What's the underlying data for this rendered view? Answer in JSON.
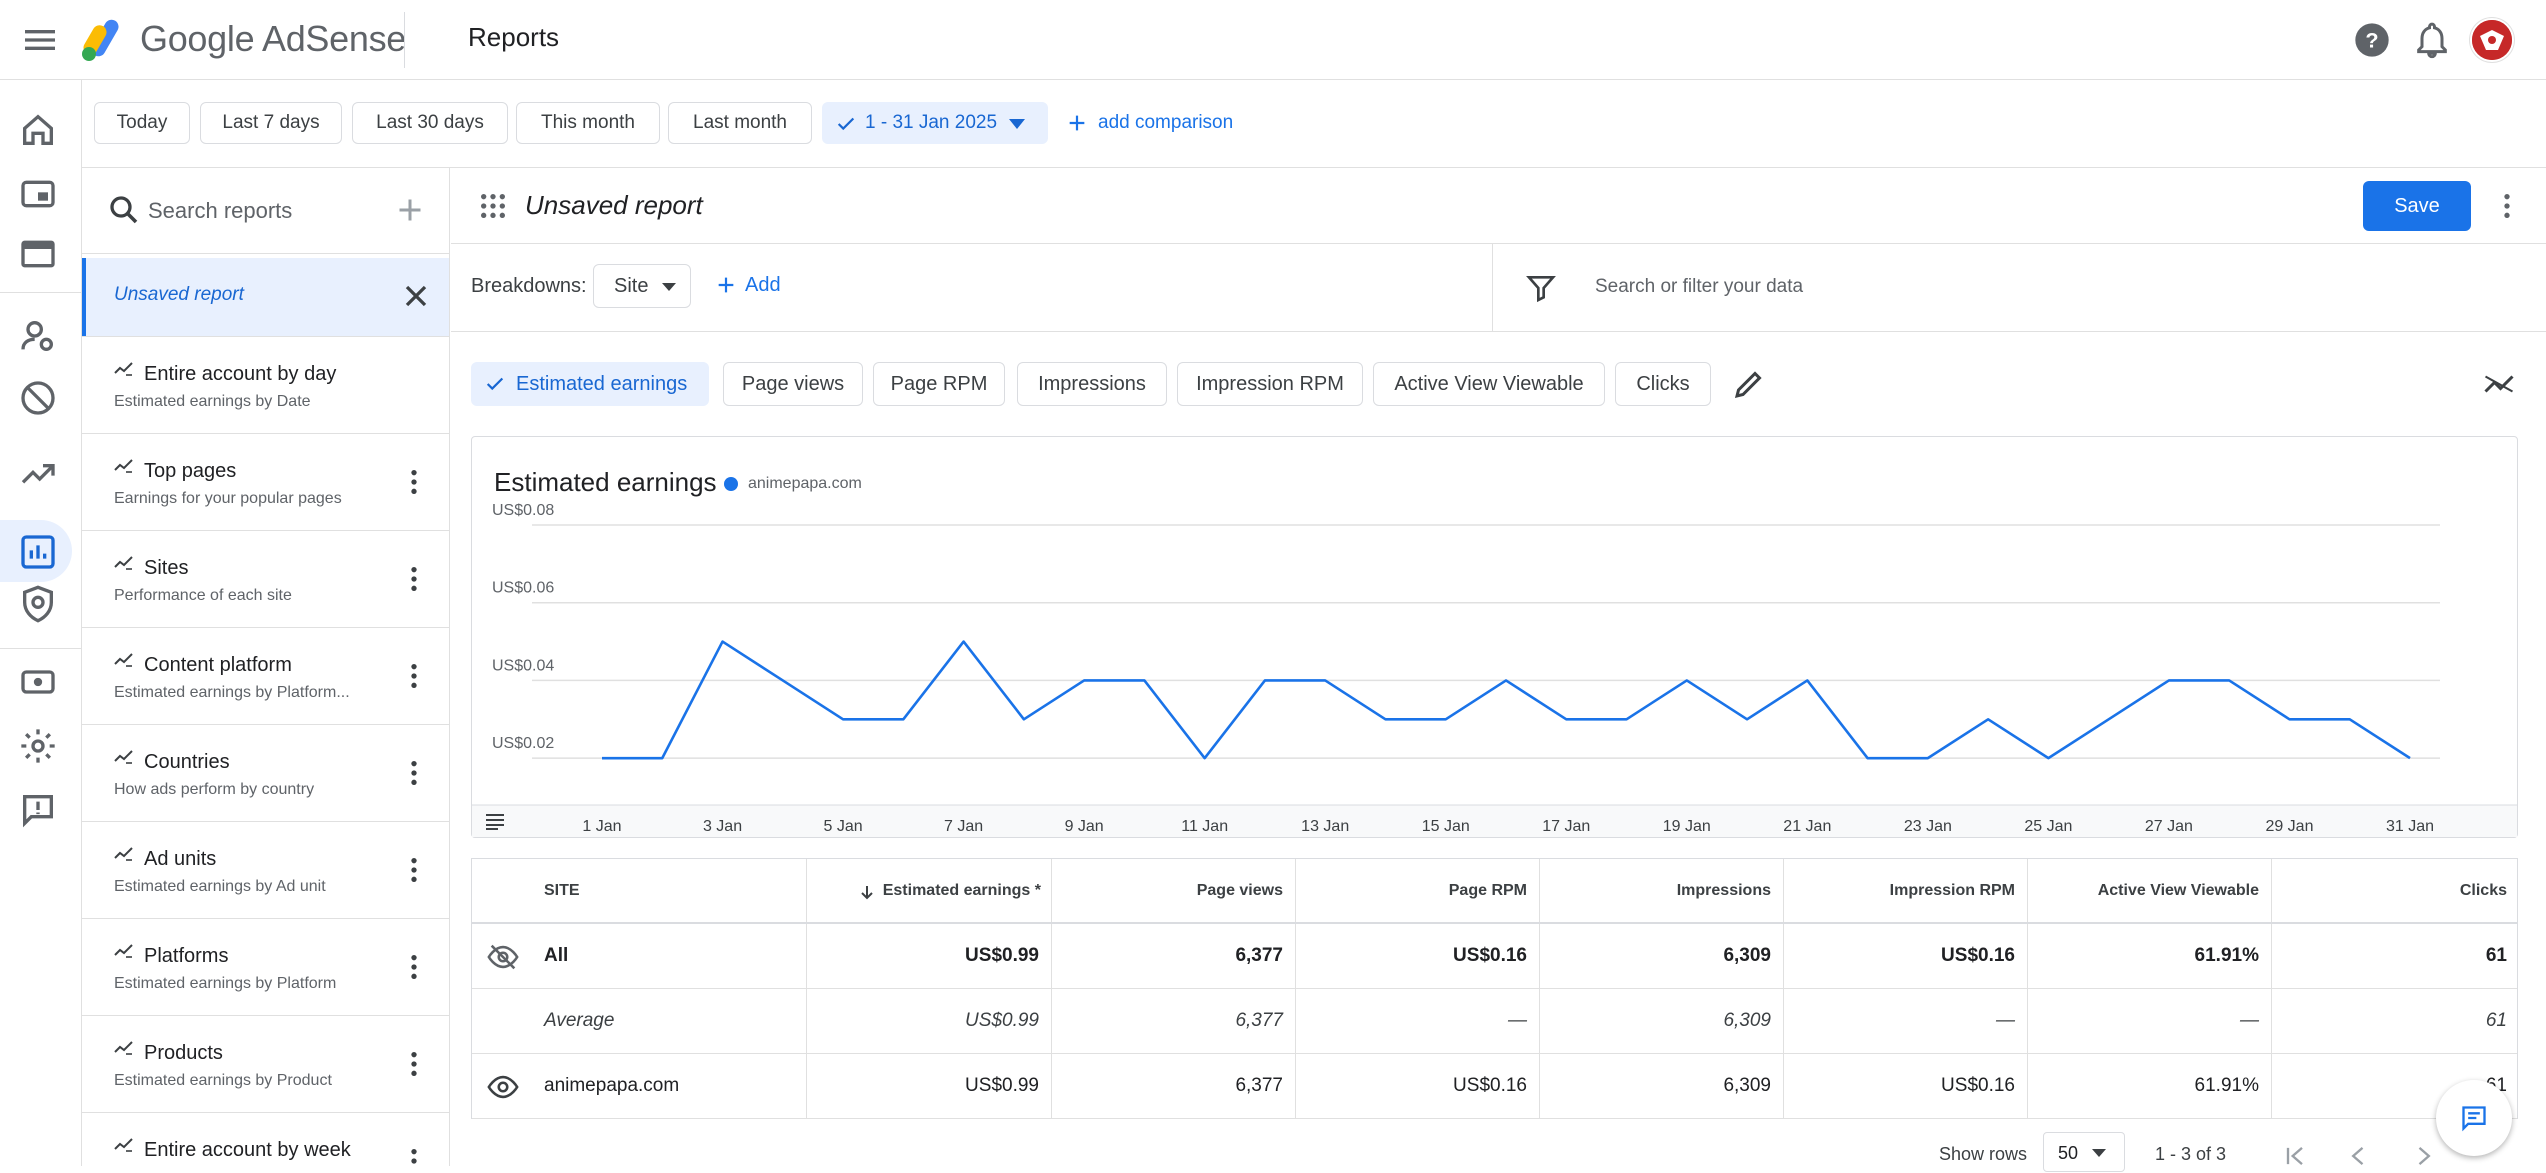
{
  "app": {
    "brand": "Google AdSense",
    "page_title": "Reports"
  },
  "date_filters": [
    "Today",
    "Last 7 days",
    "Last 30 days",
    "This month",
    "Last month"
  ],
  "date_range": "1 - 31 Jan 2025",
  "add_comparison": "add comparison",
  "search": {
    "placeholder": "Search reports"
  },
  "reports": {
    "selected": "Unsaved report",
    "items": [
      {
        "title": "Entire account by day",
        "desc": "Estimated earnings by Date"
      },
      {
        "title": "Top pages",
        "desc": "Earnings for your popular pages"
      },
      {
        "title": "Sites",
        "desc": "Performance of each site"
      },
      {
        "title": "Content platform",
        "desc": "Estimated earnings by Platform..."
      },
      {
        "title": "Countries",
        "desc": "How ads perform by country"
      },
      {
        "title": "Ad units",
        "desc": "Estimated earnings by Ad unit"
      },
      {
        "title": "Platforms",
        "desc": "Estimated earnings by Platform"
      },
      {
        "title": "Products",
        "desc": "Estimated earnings by Product"
      },
      {
        "title": "Entire account by week",
        "desc": ""
      }
    ]
  },
  "report": {
    "title": "Unsaved report",
    "save_label": "Save"
  },
  "breakdowns": {
    "label": "Breakdowns:",
    "selected": "Site",
    "add": "Add"
  },
  "filter": {
    "placeholder": "Search or filter your data"
  },
  "metrics": [
    "Estimated earnings",
    "Page views",
    "Page RPM",
    "Impressions",
    "Impression RPM",
    "Active View Viewable",
    "Clicks"
  ],
  "chart_data": {
    "type": "line",
    "title": "Estimated earnings",
    "series": [
      {
        "name": "animepapa.com",
        "color": "#1a73e8",
        "values": [
          0.02,
          0.02,
          0.05,
          0.04,
          0.03,
          0.03,
          0.05,
          0.03,
          0.04,
          0.04,
          0.02,
          0.04,
          0.04,
          0.03,
          0.03,
          0.04,
          0.03,
          0.03,
          0.04,
          0.03,
          0.04,
          0.02,
          0.02,
          0.03,
          0.02,
          0.03,
          0.04,
          0.04,
          0.03,
          0.03,
          0.02
        ]
      }
    ],
    "x_ticks": [
      "1 Jan",
      "3 Jan",
      "5 Jan",
      "7 Jan",
      "9 Jan",
      "11 Jan",
      "13 Jan",
      "15 Jan",
      "17 Jan",
      "19 Jan",
      "21 Jan",
      "23 Jan",
      "25 Jan",
      "27 Jan",
      "29 Jan",
      "31 Jan"
    ],
    "y_ticks": [
      "US$0.08",
      "US$0.06",
      "US$0.04",
      "US$0.02"
    ],
    "ylim": [
      0.01,
      0.08
    ],
    "grid": true
  },
  "table": {
    "headers": [
      "SITE",
      "Estimated earnings *",
      "Page views",
      "Page RPM",
      "Impressions",
      "Impression RPM",
      "Active View Viewable",
      "Clicks"
    ],
    "rows": [
      [
        "All",
        "US$0.99",
        "6,377",
        "US$0.16",
        "6,309",
        "US$0.16",
        "61.91%",
        "61"
      ],
      [
        "Average",
        "US$0.99",
        "6,377",
        "—",
        "6,309",
        "—",
        "—",
        "61"
      ],
      [
        "animepapa.com",
        "US$0.99",
        "6,377",
        "US$0.16",
        "6,309",
        "US$0.16",
        "61.91%",
        "61"
      ]
    ]
  },
  "pagination": {
    "show_rows_label": "Show rows",
    "rows": "50",
    "range": "1 - 3 of 3"
  }
}
